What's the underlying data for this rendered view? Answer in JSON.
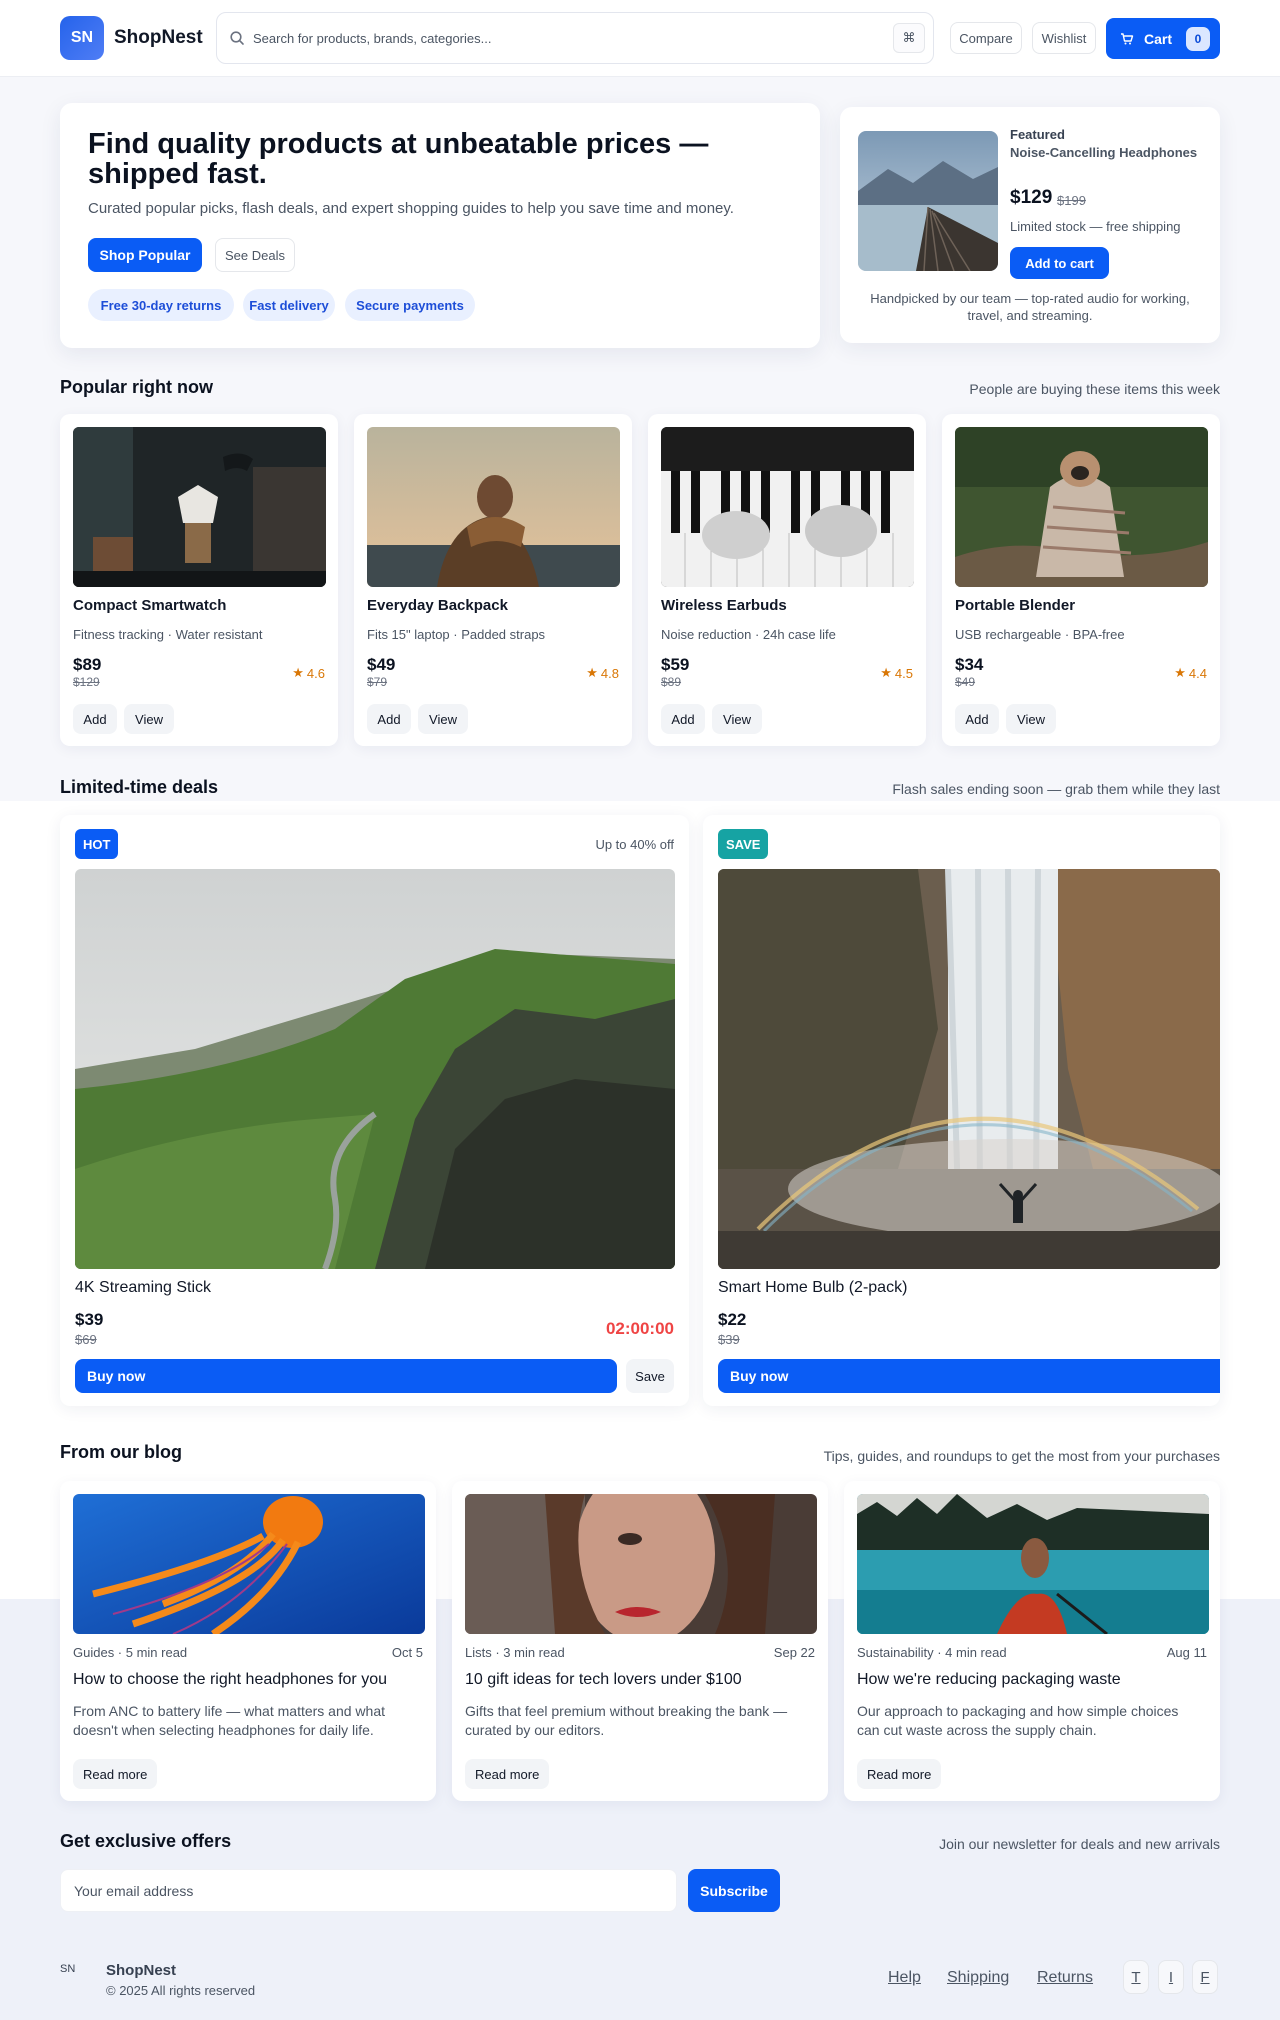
{
  "brand": {
    "logo_initials": "SN",
    "name": "ShopNest",
    "accent": "#0a5cf5"
  },
  "header": {
    "search_placeholder": "Search for products, brands, categories...",
    "shortcut": "⌘",
    "compare": "Compare",
    "wishlist": "Wishlist",
    "cart_label": "Cart",
    "cart_count": "0"
  },
  "hero": {
    "title": "Find quality products at unbeatable prices — shipped fast.",
    "subtitle": "Curated popular picks, flash deals, and expert shopping guides to help you save time and money.",
    "primary_cta": "Shop Popular",
    "secondary_cta": "See Deals",
    "pills": [
      "Free 30-day returns",
      "Fast delivery",
      "Secure payments"
    ]
  },
  "featured": {
    "label": "Featured",
    "name": "Noise-Cancelling Headphones",
    "price": "$129",
    "old_price": "$199",
    "stock": "Limited stock — free shipping",
    "cta": "Add to cart",
    "description": "Handpicked by our team — top-rated audio for working, travel, and streaming."
  },
  "popular": {
    "title": "Popular right now",
    "note": "People are buying these items this week",
    "add_label": "Add",
    "view_label": "View",
    "items": [
      {
        "name": "Compact Smartwatch",
        "meta": "Fitness tracking · Water resistant",
        "price": "$89",
        "old_price": "$129",
        "rating": "4.6"
      },
      {
        "name": "Everyday Backpack",
        "meta": "Fits 15\" laptop · Padded straps",
        "price": "$49",
        "old_price": "$79",
        "rating": "4.8"
      },
      {
        "name": "Wireless Earbuds",
        "meta": "Noise reduction · 24h case life",
        "price": "$59",
        "old_price": "$89",
        "rating": "4.5"
      },
      {
        "name": "Portable Blender",
        "meta": "USB rechargeable · BPA-free",
        "price": "$34",
        "old_price": "$49",
        "rating": "4.4"
      }
    ]
  },
  "deals": {
    "title": "Limited-time deals",
    "note": "Flash sales ending soon — grab them while they last",
    "buy_label": "Buy now",
    "save_label": "Save",
    "items": [
      {
        "badge": "HOT",
        "badge_color": "#0a5cf5",
        "note": "Up to 40% off",
        "name": "4K Streaming Stick",
        "price": "$39",
        "old_price": "$69",
        "timer": "02:00:00"
      },
      {
        "badge": "SAVE",
        "badge_color": "#16a3a3",
        "name": "Smart Home Bulb (2-pack)",
        "price": "$22",
        "old_price": "$39"
      }
    ]
  },
  "blog": {
    "title": "From our blog",
    "note": "Tips, guides, and roundups to get the most from your purchases",
    "read_label": "Read more",
    "posts": [
      {
        "meta": "Guides · 5 min read",
        "date": "Oct 5",
        "title": "How to choose the right headphones for you",
        "desc": "From ANC to battery life — what matters and what doesn't when selecting headphones for daily life."
      },
      {
        "meta": "Lists · 3 min read",
        "date": "Sep 22",
        "title": "10 gift ideas for tech lovers under $100",
        "desc": "Gifts that feel premium without breaking the bank — curated by our editors."
      },
      {
        "meta": "Sustainability · 4 min read",
        "date": "Aug 11",
        "title": "How we're reducing packaging waste",
        "desc": "Our approach to packaging and how simple choices can cut waste across the supply chain."
      }
    ]
  },
  "newsletter": {
    "title": "Get exclusive offers",
    "note": "Join our newsletter for deals and new arrivals",
    "placeholder": "Your email address",
    "cta": "Subscribe"
  },
  "footer": {
    "logo_initials": "SN",
    "name": "ShopNest",
    "copyright": "© 2025 All rights reserved",
    "links": [
      "Help",
      "Shipping",
      "Returns"
    ],
    "social": [
      "T",
      "I",
      "F"
    ]
  }
}
